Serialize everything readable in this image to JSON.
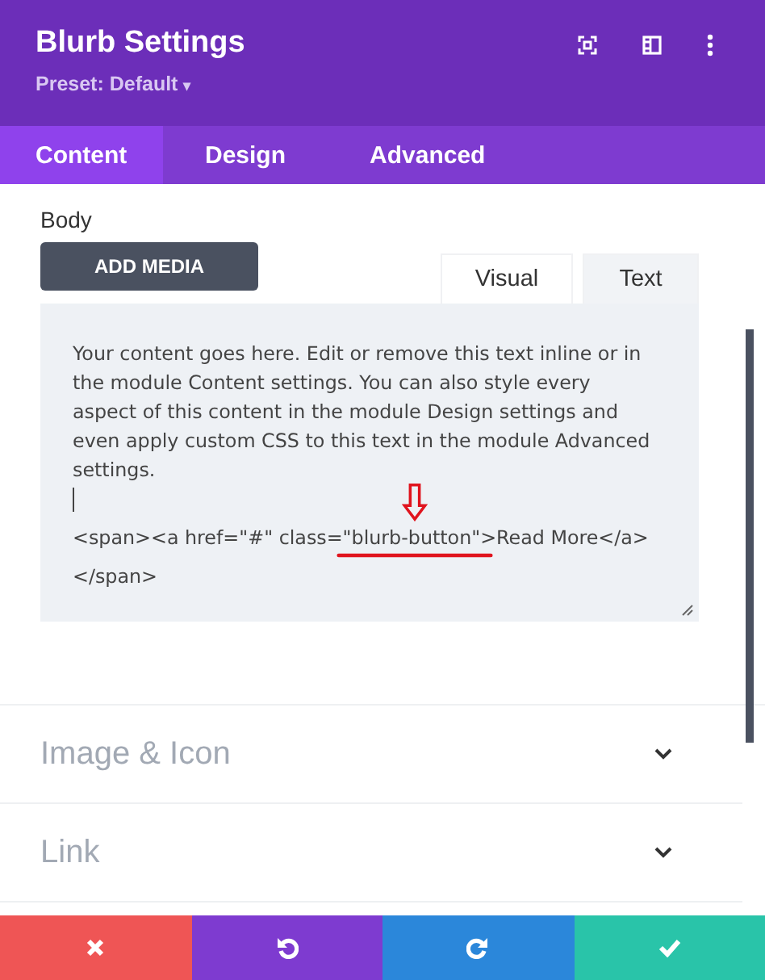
{
  "header": {
    "title": "Blurb Settings",
    "preset": "Preset: Default",
    "preset_caret": "▾"
  },
  "tabs": [
    {
      "label": "Content",
      "selected": true
    },
    {
      "label": "Design",
      "selected": false
    },
    {
      "label": "Advanced",
      "selected": false
    }
  ],
  "body": {
    "label": "Body",
    "add_media": "ADD MEDIA",
    "editor_tabs": [
      {
        "label": "Visual",
        "selected": false
      },
      {
        "label": "Text",
        "selected": true
      }
    ],
    "paragraph": "Your content goes here. Edit or remove this text inline or in the module Content settings. You can also style every aspect of this content in the module Design settings and even apply custom CSS to this text in the module Advanced settings.",
    "code_lines": [
      "<span><a href=\"#\" class=\"blurb-button\">Read More</a>",
      "</span>"
    ]
  },
  "sections": [
    {
      "label": "Image & Icon",
      "expanded": false
    },
    {
      "label": "Link",
      "expanded": false
    }
  ],
  "footer": [
    {
      "kind": "cancel"
    },
    {
      "kind": "undo"
    },
    {
      "kind": "redo"
    },
    {
      "kind": "save"
    }
  ]
}
